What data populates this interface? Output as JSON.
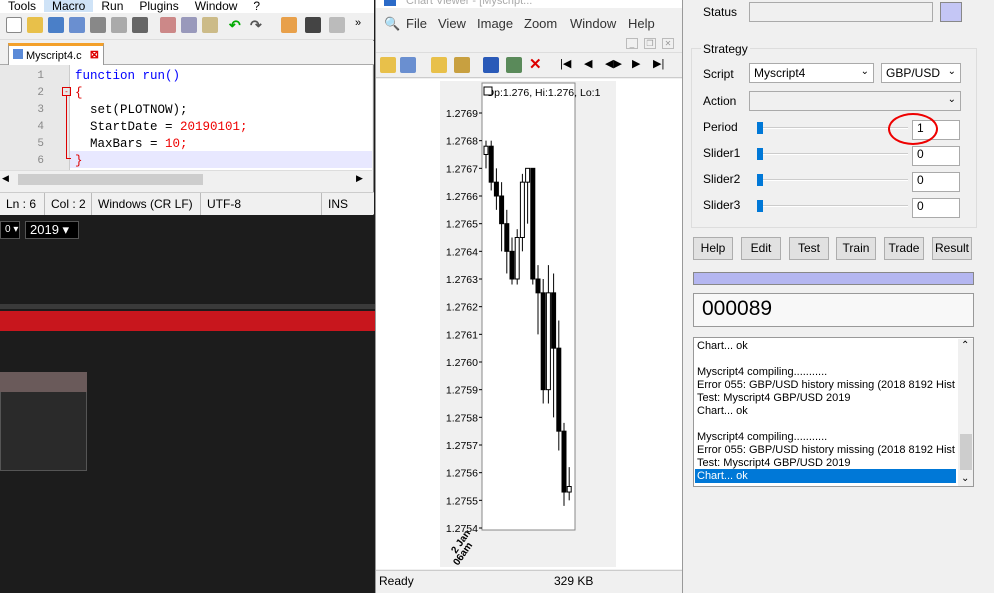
{
  "npp": {
    "menu": [
      "Tools",
      "Macro",
      "Run",
      "Plugins",
      "Window",
      "?"
    ],
    "tab_label": "Myscript4.c",
    "lines": [
      {
        "num": "1",
        "code_a": "function run()",
        "kw": "",
        "str": ""
      },
      {
        "num": "2",
        "code_a": "{",
        "kw": "",
        "str": ""
      },
      {
        "num": "3",
        "code_a": "  set(PLOTNOW);",
        "kw": "",
        "str": ""
      },
      {
        "num": "4",
        "code_a": "  StartDate = ",
        "kw": "",
        "str": "20190101;"
      },
      {
        "num": "5",
        "code_a": "  MaxBars = ",
        "kw": "",
        "str": "10;"
      },
      {
        "num": "6",
        "code_a": "}",
        "kw": "",
        "str": ""
      }
    ],
    "status": {
      "ln": "Ln : 6",
      "col": "Col : 2",
      "eol": "Windows (CR LF)",
      "enc": "UTF-8",
      "mode": "INS"
    }
  },
  "dark": {
    "year": "2019",
    "left_sel": "0"
  },
  "chart_viewer": {
    "title": "Chart Viewer - [Myscript...",
    "menu": [
      "File",
      "View",
      "Image",
      "Zoom",
      "Window",
      "Help"
    ],
    "ohlc": "Op:1.276, Hi:1.276, Lo:1",
    "status_left": "Ready",
    "status_size": "329 KB",
    "xlabel": "2 Jan",
    "xlabel2": "06am"
  },
  "chart_data": {
    "type": "candlestick",
    "yticks": [
      "1.2769",
      "1.2768",
      "1.2767",
      "1.2766",
      "1.2765",
      "1.2764",
      "1.2763",
      "1.2762",
      "1.2761",
      "1.2760",
      "1.2759",
      "1.2758",
      "1.2757",
      "1.2756",
      "1.2755",
      "1.2754"
    ],
    "ylim": [
      1.2754,
      1.2769
    ],
    "candles": [
      {
        "o": 1.27675,
        "c": 1.27678,
        "h": 1.2768,
        "l": 1.2767
      },
      {
        "o": 1.27678,
        "c": 1.27665,
        "h": 1.2768,
        "l": 1.27662
      },
      {
        "o": 1.27665,
        "c": 1.2766,
        "h": 1.2767,
        "l": 1.27655
      },
      {
        "o": 1.2766,
        "c": 1.2765,
        "h": 1.27665,
        "l": 1.2764
      },
      {
        "o": 1.2765,
        "c": 1.2764,
        "h": 1.27655,
        "l": 1.27632
      },
      {
        "o": 1.2764,
        "c": 1.2763,
        "h": 1.27645,
        "l": 1.27628
      },
      {
        "o": 1.2763,
        "c": 1.27645,
        "h": 1.27648,
        "l": 1.27628
      },
      {
        "o": 1.27645,
        "c": 1.27665,
        "h": 1.27668,
        "l": 1.2764
      },
      {
        "o": 1.27665,
        "c": 1.2767,
        "h": 1.2767,
        "l": 1.2765
      },
      {
        "o": 1.2767,
        "c": 1.2763,
        "h": 1.2767,
        "l": 1.27628
      },
      {
        "o": 1.2763,
        "c": 1.27625,
        "h": 1.27635,
        "l": 1.2761
      },
      {
        "o": 1.27625,
        "c": 1.2759,
        "h": 1.2763,
        "l": 1.27585
      },
      {
        "o": 1.2759,
        "c": 1.27625,
        "h": 1.27635,
        "l": 1.27585
      },
      {
        "o": 1.27625,
        "c": 1.27605,
        "h": 1.27632,
        "l": 1.2758
      },
      {
        "o": 1.27605,
        "c": 1.27575,
        "h": 1.27615,
        "l": 1.27568
      },
      {
        "o": 1.27575,
        "c": 1.27553,
        "h": 1.27578,
        "l": 1.27548
      },
      {
        "o": 1.27553,
        "c": 1.27555,
        "h": 1.27562,
        "l": 1.2755
      }
    ]
  },
  "zorro": {
    "status_label": "Status",
    "strategy_label": "Strategy",
    "script_label": "Script",
    "script_value": "Myscript4",
    "asset_value": "GBP/USD",
    "action_label": "Action",
    "period_label": "Period",
    "period_value": "1",
    "slider1_label": "Slider1",
    "slider1_value": "0",
    "slider2_label": "Slider2",
    "slider2_value": "0",
    "slider3_label": "Slider3",
    "slider3_value": "0",
    "buttons": [
      "Help",
      "Edit",
      "Test",
      "Train",
      "Trade",
      "Result"
    ],
    "counter": "000089",
    "log": [
      "Chart... ok",
      "",
      "Myscript4 compiling...........",
      "Error 055: GBP/USD history missing (2018 8192 Hist",
      "Test: Myscript4 GBP/USD 2019",
      "Chart... ok",
      "",
      "Myscript4 compiling...........",
      "Error 055: GBP/USD history missing (2018 8192 Hist",
      "Test: Myscript4 GBP/USD 2019",
      "Chart... ok"
    ],
    "accent": "#0078d7"
  }
}
